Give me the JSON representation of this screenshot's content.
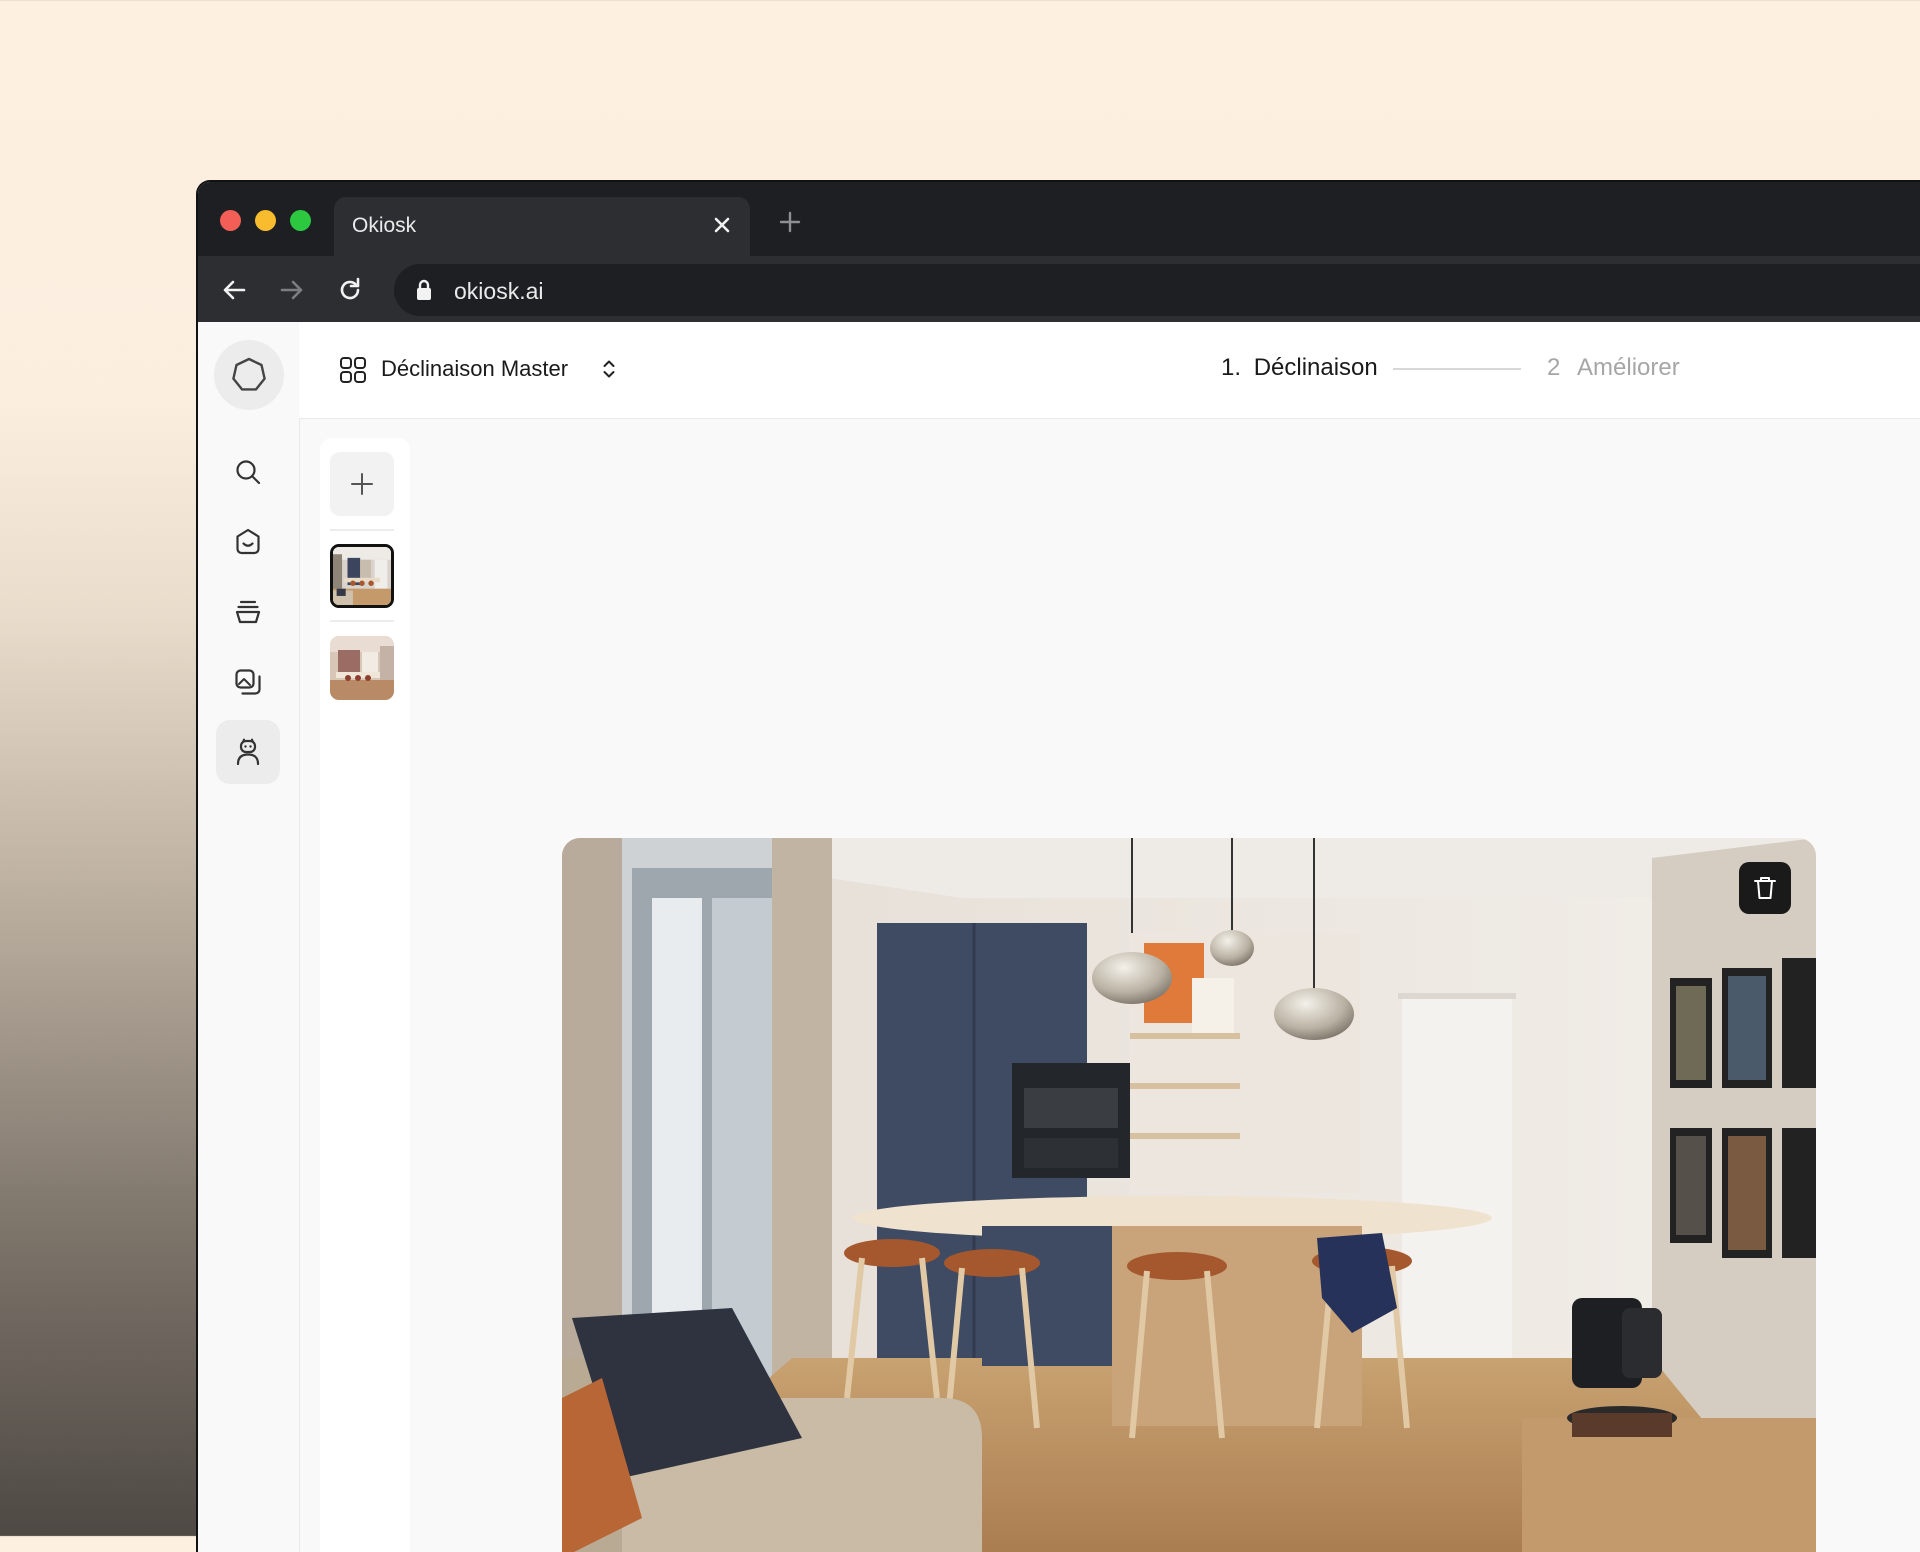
{
  "browser": {
    "tab_title": "Okiosk",
    "url": "okiosk.ai"
  },
  "header": {
    "project_title": "Déclinaison Master",
    "step1_number": "1.",
    "step1_label": "Déclinaison",
    "step2_number": "2",
    "step2_label": "Améliorer"
  },
  "sidebar": {
    "items": [
      {
        "icon": "search-icon"
      },
      {
        "icon": "home-icon"
      },
      {
        "icon": "stack-icon"
      },
      {
        "icon": "gallery-icon"
      },
      {
        "icon": "assistant-icon"
      }
    ]
  },
  "colors": {
    "accent": "#1a1a1a",
    "inactive_step": "#a6a6a6",
    "titlebar": "#1e1f22"
  }
}
